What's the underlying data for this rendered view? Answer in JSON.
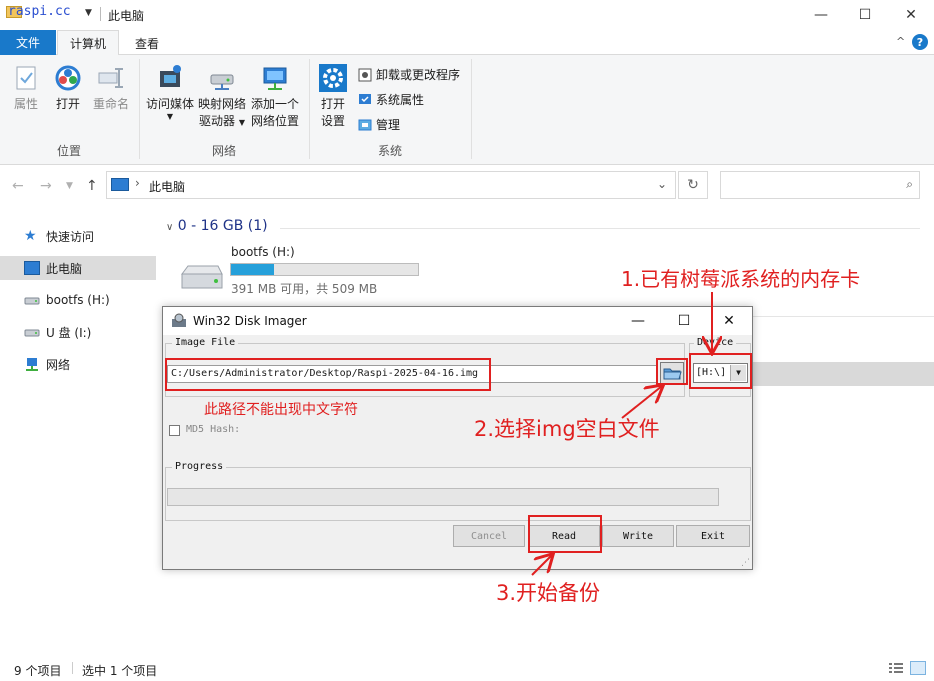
{
  "titlebar": {
    "watermark": "raspi.cc",
    "title": "此电脑",
    "minimize": "—",
    "maximize": "☐",
    "close": "✕"
  },
  "ribbon_tabs": {
    "file": "文件",
    "computer": "计算机",
    "view": "查看",
    "collapse": "^",
    "help": "?"
  },
  "ribbon": {
    "location_group": {
      "label": "位置",
      "properties": "属性",
      "open": "打开",
      "rename": "重命名"
    },
    "network_group": {
      "label": "网络",
      "access_media": "访问媒体",
      "map_drive_line1": "映射网络",
      "map_drive_line2": "驱动器",
      "add_location_line1": "添加一个",
      "add_location_line2": "网络位置"
    },
    "system_group": {
      "label": "系统",
      "open_settings_line1": "打开",
      "open_settings_line2": "设置",
      "uninstall": "卸载或更改程序",
      "system_properties": "系统属性",
      "manage": "管理"
    }
  },
  "address": {
    "path": "此电脑",
    "search_placeholder": ""
  },
  "navpane": {
    "items": [
      {
        "label": "快速访问"
      },
      {
        "label": "此电脑"
      },
      {
        "label": "bootfs (H:)"
      },
      {
        "label": "U 盘 (I:)"
      },
      {
        "label": "网络"
      }
    ]
  },
  "content": {
    "group_header": "0 - 16 GB (1)",
    "drive_name": "bootfs (H:)",
    "drive_free": "391 MB 可用，共 509 MB",
    "drive_used_fraction": 0.23
  },
  "statusbar": {
    "count": "9 个项目",
    "selected": "选中 1 个项目"
  },
  "dialog": {
    "title": "Win32 Disk Imager",
    "image_file_label": "Image File",
    "image_path": "C:/Users/Administrator/Desktop/Raspi-2025-04-16.img",
    "device_label": "Device",
    "device_value": "[H:\\]",
    "md5_label": "MD5 Hash:",
    "progress_label": "Progress",
    "buttons": {
      "cancel": "Cancel",
      "read": "Read",
      "write": "Write",
      "exit": "Exit"
    }
  },
  "annotations": {
    "a1": "1.已有树莓派系统的内存卡",
    "a2": "2.选择img空白文件",
    "a3": "3.开始备份",
    "path_note": "此路径不能出现中文字符",
    "color": "#e02020"
  }
}
